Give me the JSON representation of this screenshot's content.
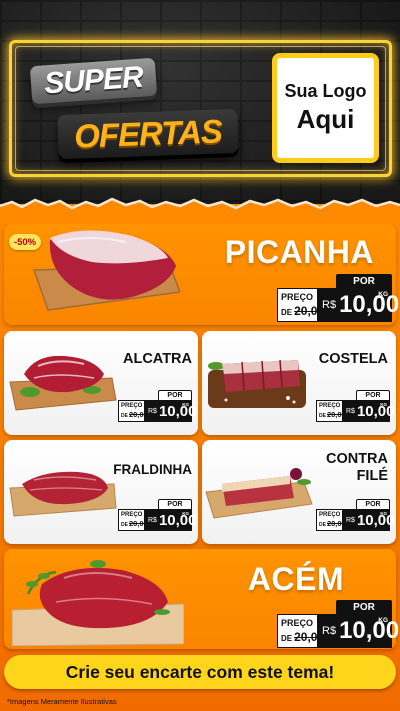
{
  "header": {
    "title_line1": "SUPER",
    "title_line2": "OFERTAS",
    "logo_line1": "Sua Logo",
    "logo_line2": "Aqui"
  },
  "colors": {
    "neon": "#ffd23a",
    "orange": "#ff8a00",
    "ofertas_text": "#ffb21a",
    "cta_bg": "#ffd51c",
    "discount_bg": "#ffe45c",
    "discount_text": "#c40000"
  },
  "products": {
    "picanha": {
      "name": "PICANHA",
      "badge": "-50%",
      "price": {
        "por": "POR",
        "label": "PREÇO",
        "de": "DE",
        "old": "20,00",
        "currency": "R$",
        "value": "10,00",
        "unit": "KG"
      }
    },
    "alcatra": {
      "name": "ALCATRA",
      "price": {
        "por": "POR",
        "label": "PREÇO",
        "de": "DE",
        "old": "20,00",
        "currency": "R$",
        "value": "10,00",
        "unit": "KG"
      }
    },
    "costela": {
      "name": "COSTELA",
      "price": {
        "por": "POR",
        "label": "PREÇO",
        "de": "DE",
        "old": "20,00",
        "currency": "R$",
        "value": "10,00",
        "unit": "KG"
      }
    },
    "fraldinha": {
      "name": "FRALDINHA",
      "price": {
        "por": "POR",
        "label": "PREÇO",
        "de": "DE",
        "old": "20,00",
        "currency": "R$",
        "value": "10,00",
        "unit": "KG"
      }
    },
    "contrafile": {
      "name_line1": "CONTRA",
      "name_line2": "FILÉ",
      "price": {
        "por": "POR",
        "label": "PREÇO",
        "de": "DE",
        "old": "20,00",
        "currency": "R$",
        "value": "10,00",
        "unit": "KG"
      }
    },
    "acem": {
      "name": "ACÉM",
      "price": {
        "por": "POR",
        "label": "PREÇO",
        "de": "DE",
        "old": "20,00",
        "currency": "R$",
        "value": "10,00",
        "unit": "KG"
      }
    }
  },
  "cta": "Crie seu encarte com este tema!",
  "footnote": "*Imagens Meramente Ilustrativas"
}
